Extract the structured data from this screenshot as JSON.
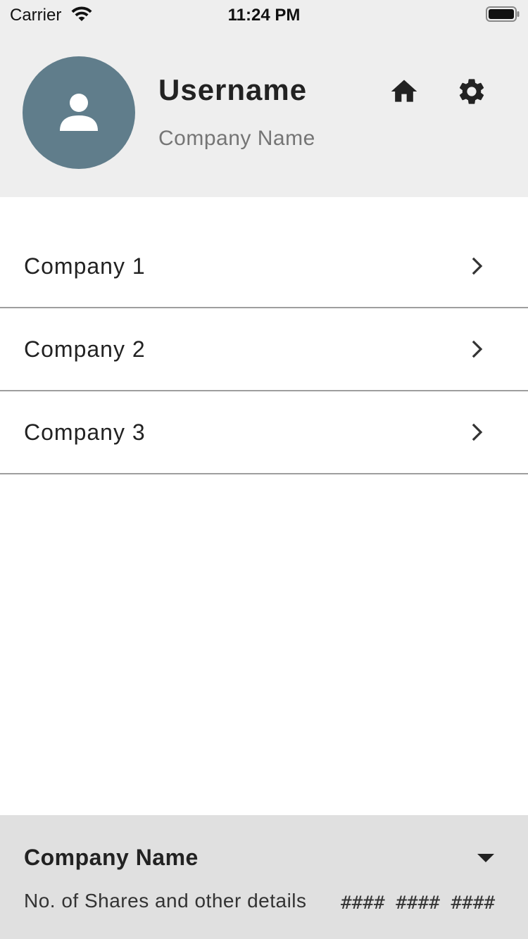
{
  "status_bar": {
    "carrier": "Carrier",
    "time": "11:24 PM",
    "wifi_icon": "wifi-icon",
    "battery_icon": "battery-icon"
  },
  "header": {
    "username": "Username",
    "company_name": "Company Name",
    "avatar_icon": "person-icon",
    "home_icon": "home-icon",
    "settings_icon": "gear-icon",
    "avatar_color": "#607d8b",
    "background": "#eeeeee"
  },
  "companies": [
    {
      "label": "Company 1",
      "icon": "chevron-right-icon"
    },
    {
      "label": "Company 2",
      "icon": "chevron-right-icon"
    },
    {
      "label": "Company 3",
      "icon": "chevron-right-icon"
    }
  ],
  "bottom_panel": {
    "title": "Company Name",
    "details": "No. of Shares and other details",
    "value": "#### #### ####",
    "dropdown_icon": "caret-down-icon",
    "background": "#e0e0e0"
  }
}
